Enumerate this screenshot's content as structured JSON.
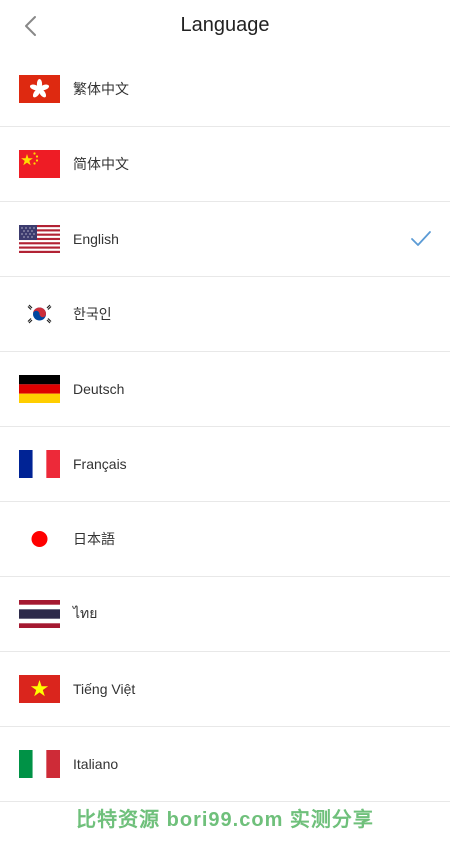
{
  "header": {
    "title": "Language",
    "back_icon": "chevron-left-icon"
  },
  "languages": [
    {
      "label": "繁体中文",
      "flag": "hong-kong-flag-icon",
      "selected": false
    },
    {
      "label": "简体中文",
      "flag": "china-flag-icon",
      "selected": false
    },
    {
      "label": "English",
      "flag": "us-flag-icon",
      "selected": true
    },
    {
      "label": "한국인",
      "flag": "korea-flag-icon",
      "selected": false
    },
    {
      "label": "Deutsch",
      "flag": "germany-flag-icon",
      "selected": false
    },
    {
      "label": "Français",
      "flag": "france-flag-icon",
      "selected": false
    },
    {
      "label": "日本語",
      "flag": "japan-flag-icon",
      "selected": false
    },
    {
      "label": "ไทย",
      "flag": "thailand-flag-icon",
      "selected": false
    },
    {
      "label": "Tiếng Việt",
      "flag": "vietnam-flag-icon",
      "selected": false
    },
    {
      "label": "Italiano",
      "flag": "italy-flag-icon",
      "selected": false
    }
  ],
  "colors": {
    "check": "#5b9bd5",
    "watermark": "#6fc07b"
  },
  "watermark": "比特资源  bori99.com  实测分享"
}
